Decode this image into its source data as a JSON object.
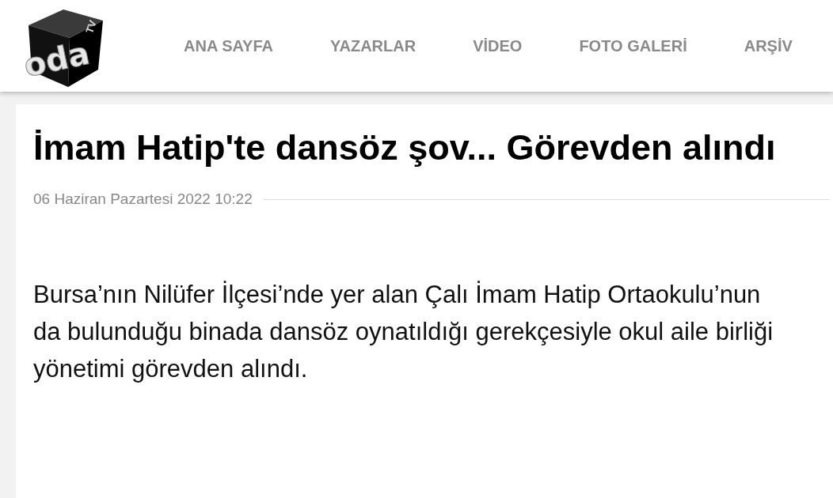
{
  "logo": {
    "text": "oda",
    "superscript": "TV"
  },
  "nav": [
    {
      "label": "ANA SAYFA"
    },
    {
      "label": "YAZARLAR"
    },
    {
      "label": "VİDEO"
    },
    {
      "label": "FOTO GALERİ"
    },
    {
      "label": "ARŞİV"
    }
  ],
  "article": {
    "title": "İmam Hatip'te dansöz şov... Görevden alındı",
    "date": "06 Haziran Pazartesi 2022 10:22",
    "lead": "Bursa’nın Nilüfer İlçesi’nde yer alan Çalı İmam Hatip Ortaokulu’nun da bulunduğu binada dansöz oynatıldığı gerekçesiyle okul aile birliği yönetimi görevden alındı."
  }
}
